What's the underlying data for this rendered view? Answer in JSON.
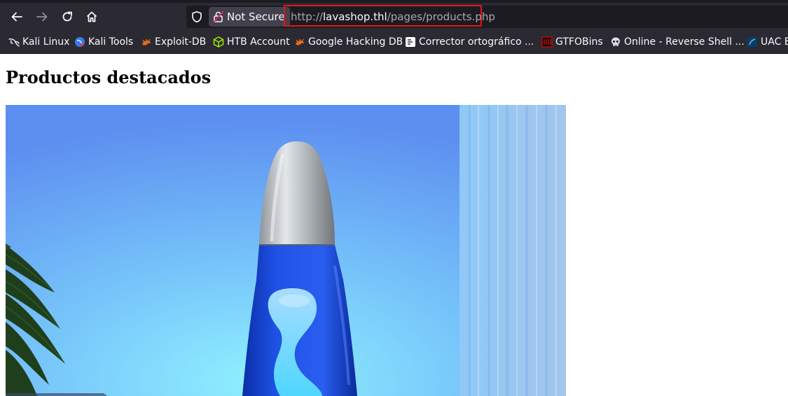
{
  "browser": {
    "security_label": "Not Secure",
    "url": {
      "scheme": "http://",
      "host": "lavashop.thl",
      "path": "/pages/products.php"
    },
    "highlight_color": "#e8141c"
  },
  "bookmarks": [
    {
      "label": "Kali Linux",
      "icon": "kali-dragon-icon"
    },
    {
      "label": "Kali Tools",
      "icon": "kali-tools-icon"
    },
    {
      "label": "Exploit-DB",
      "icon": "exploit-db-icon"
    },
    {
      "label": "HTB Account",
      "icon": "htb-cube-icon"
    },
    {
      "label": "Google Hacking DB",
      "icon": "ghdb-icon"
    },
    {
      "label": "Corrector ortográfico ...",
      "icon": "corrector-icon"
    },
    {
      "label": "GTFOBins",
      "icon": "gtfobins-icon"
    },
    {
      "label": "Online - Reverse Shell ...",
      "icon": "skull-icon"
    },
    {
      "label": "UAC B",
      "icon": "uac-icon"
    }
  ],
  "page": {
    "title": "Productos destacados",
    "product_image": "lava-lamp-image"
  }
}
